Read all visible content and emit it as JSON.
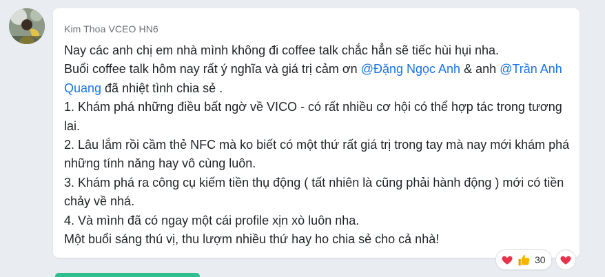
{
  "message": {
    "sender_name": "Kim Thoa VCEO HN6",
    "lines": [
      {
        "segments": [
          {
            "text": "Nay các anh chị em nhà mình không đi coffee talk chắc hẳn sẽ tiếc hùi hụi nha."
          }
        ]
      },
      {
        "segments": [
          {
            "text": "Buổi coffee talk hôm nay rất ý nghĩa và giá trị cảm ơn "
          },
          {
            "text": "@Đặng Ngọc Anh",
            "mention": true
          },
          {
            "text": " & anh  "
          },
          {
            "text": "@Trần Anh Quang",
            "mention": true
          },
          {
            "text": "  đã nhiệt tình chia sẻ ."
          }
        ]
      },
      {
        "segments": [
          {
            "text": "1. Khám phá những điều bất ngờ về VICO - có rất nhiều cơ hội có thể hợp tác trong tương lai."
          }
        ]
      },
      {
        "segments": [
          {
            "text": "2. Lâu lắm rồi cầm thẻ NFC mà ko biết có một thứ rất giá trị trong tay mà nay mới khám phá những tính năng hay vô cùng luôn."
          }
        ]
      },
      {
        "segments": [
          {
            "text": "3. Khám phá ra công cụ kiếm tiền thụ  động ( tất nhiên là cũng phải hành động ) mới có tiền chảy về nhá."
          }
        ]
      },
      {
        "segments": [
          {
            "text": "4. Và mình đã có ngay một cái profile xịn xò luôn nha."
          }
        ]
      },
      {
        "segments": [
          {
            "text": "Một buổi sáng thú vị, thu lượm nhiều thứ hay ho chia sẻ cho cả nhà!"
          }
        ]
      }
    ]
  },
  "reactions": {
    "icons": [
      "heart-icon",
      "thumbs-up-icon"
    ],
    "count": "30",
    "quick_react_icon": "heart-icon"
  },
  "colors": {
    "mention": "#1a73e8",
    "heart": "#e8334a",
    "thumb": "#f7b500",
    "accent_bar": "#2fbf8f"
  }
}
